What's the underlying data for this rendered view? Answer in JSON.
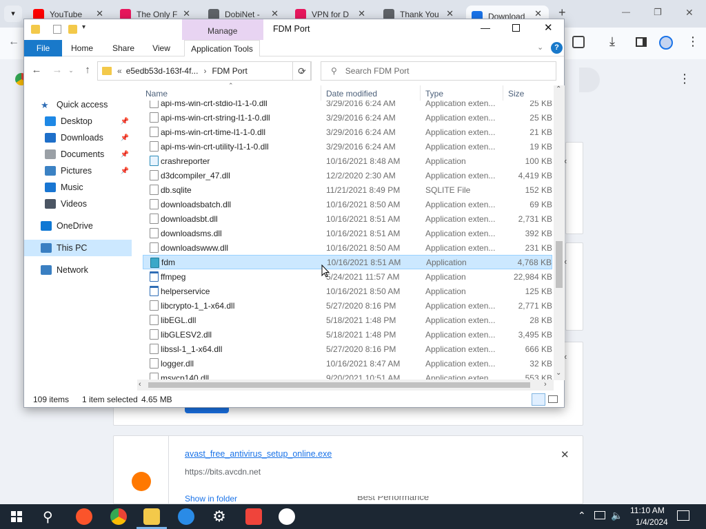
{
  "browser": {
    "tabs": [
      {
        "title": "YouTube",
        "icon": "youtube-icon",
        "color": "#ff0000"
      },
      {
        "title": "The Only F",
        "icon": "android-icon",
        "color": "#e8175d"
      },
      {
        "title": "DobiNet -",
        "icon": "globe-icon",
        "color": "#5f6368"
      },
      {
        "title": "VPN for D",
        "icon": "android-icon",
        "color": "#e8175d"
      },
      {
        "title": "Thank You",
        "icon": "globe-icon",
        "color": "#5f6368"
      },
      {
        "title": "Download",
        "icon": "download-icon",
        "color": "#1a73e8"
      }
    ],
    "new_tab": "+",
    "window_controls": {
      "minimize": "—",
      "maximize": "❐",
      "close": "✕"
    }
  },
  "downloads_page": {
    "item_filename": "avast_free_antivirus_setup_online.exe",
    "item_url": "https://bits.avcdn.net",
    "show_in_folder": "Show in folder",
    "bg_hint": "Best Performance"
  },
  "explorer": {
    "title": "FDM Port",
    "manage_label": "Manage",
    "ribbon_tabs": [
      "File",
      "Home",
      "Share",
      "View",
      "Application Tools"
    ],
    "address": {
      "part1": "e5edb53d-163f-4f...",
      "sep": "›",
      "part2": "FDM Port"
    },
    "search_placeholder": "Search FDM Port",
    "columns": {
      "name": "Name",
      "date": "Date modified",
      "type": "Type",
      "size": "Size"
    },
    "nav": [
      {
        "label": "Quick access",
        "icon": "star-icon",
        "color": "#2f6db5",
        "indent": 0,
        "pinned": false
      },
      {
        "label": "Desktop",
        "icon": "desktop-icon",
        "color": "#1e88e5",
        "indent": 1,
        "pinned": true
      },
      {
        "label": "Downloads",
        "icon": "downloads-icon",
        "color": "#1e6fc9",
        "indent": 1,
        "pinned": true
      },
      {
        "label": "Documents",
        "icon": "documents-icon",
        "color": "#9aa0a6",
        "indent": 1,
        "pinned": true
      },
      {
        "label": "Pictures",
        "icon": "pictures-icon",
        "color": "#3b82c4",
        "indent": 1,
        "pinned": true
      },
      {
        "label": "Music",
        "icon": "music-icon",
        "color": "#1976d2",
        "indent": 1,
        "pinned": false
      },
      {
        "label": "Videos",
        "icon": "videos-icon",
        "color": "#4b5563",
        "indent": 1,
        "pinned": false
      },
      {
        "label": "OneDrive",
        "icon": "onedrive-icon",
        "color": "#0f78d4",
        "indent": 0,
        "pinned": false
      },
      {
        "label": "This PC",
        "icon": "computer-icon",
        "color": "#3a7fc2",
        "indent": 0,
        "pinned": false
      },
      {
        "label": "Network",
        "icon": "network-icon",
        "color": "#3a7fc2",
        "indent": 0,
        "pinned": false
      }
    ],
    "files": [
      {
        "name": "api-ms-win-crt-stdio-l1-1-0.dll",
        "date": "3/29/2016 6:24 AM",
        "type": "Application exten...",
        "size": "25 KB",
        "kind": "dll"
      },
      {
        "name": "api-ms-win-crt-string-l1-1-0.dll",
        "date": "3/29/2016 6:24 AM",
        "type": "Application exten...",
        "size": "25 KB",
        "kind": "dll"
      },
      {
        "name": "api-ms-win-crt-time-l1-1-0.dll",
        "date": "3/29/2016 6:24 AM",
        "type": "Application exten...",
        "size": "21 KB",
        "kind": "dll"
      },
      {
        "name": "api-ms-win-crt-utility-l1-1-0.dll",
        "date": "3/29/2016 6:24 AM",
        "type": "Application exten...",
        "size": "19 KB",
        "kind": "dll"
      },
      {
        "name": "crashreporter",
        "date": "10/16/2021 8:48 AM",
        "type": "Application",
        "size": "100 KB",
        "kind": "crash"
      },
      {
        "name": "d3dcompiler_47.dll",
        "date": "12/2/2020 2:30 AM",
        "type": "Application exten...",
        "size": "4,419 KB",
        "kind": "dll"
      },
      {
        "name": "db.sqlite",
        "date": "11/21/2021 8:49 PM",
        "type": "SQLITE File",
        "size": "152 KB",
        "kind": "file"
      },
      {
        "name": "downloadsbatch.dll",
        "date": "10/16/2021 8:50 AM",
        "type": "Application exten...",
        "size": "69 KB",
        "kind": "dll"
      },
      {
        "name": "downloadsbt.dll",
        "date": "10/16/2021 8:51 AM",
        "type": "Application exten...",
        "size": "2,731 KB",
        "kind": "dll"
      },
      {
        "name": "downloadsms.dll",
        "date": "10/16/2021 8:51 AM",
        "type": "Application exten...",
        "size": "392 KB",
        "kind": "dll"
      },
      {
        "name": "downloadswww.dll",
        "date": "10/16/2021 8:50 AM",
        "type": "Application exten...",
        "size": "231 KB",
        "kind": "dll"
      },
      {
        "name": "fdm",
        "date": "10/16/2021 8:51 AM",
        "type": "Application",
        "size": "4,768 KB",
        "kind": "fdm",
        "selected": true
      },
      {
        "name": "ffmpeg",
        "date": "5/24/2021 11:57 AM",
        "type": "Application",
        "size": "22,984 KB",
        "kind": "app"
      },
      {
        "name": "helperservice",
        "date": "10/16/2021 8:50 AM",
        "type": "Application",
        "size": "125 KB",
        "kind": "app"
      },
      {
        "name": "libcrypto-1_1-x64.dll",
        "date": "5/27/2020 8:16 PM",
        "type": "Application exten...",
        "size": "2,771 KB",
        "kind": "dll"
      },
      {
        "name": "libEGL.dll",
        "date": "5/18/2021 1:48 PM",
        "type": "Application exten...",
        "size": "28 KB",
        "kind": "dll"
      },
      {
        "name": "libGLESV2.dll",
        "date": "5/18/2021 1:48 PM",
        "type": "Application exten...",
        "size": "3,495 KB",
        "kind": "dll"
      },
      {
        "name": "libssl-1_1-x64.dll",
        "date": "5/27/2020 8:16 PM",
        "type": "Application exten...",
        "size": "666 KB",
        "kind": "dll"
      },
      {
        "name": "logger.dll",
        "date": "10/16/2021 8:47 AM",
        "type": "Application exten...",
        "size": "32 KB",
        "kind": "dll"
      },
      {
        "name": "msvcp140.dll",
        "date": "9/20/2021 10:51 AM",
        "type": "Application exten...",
        "size": "553 KB",
        "kind": "dll"
      }
    ],
    "status": {
      "count": "109 items",
      "selected": "1 item selected",
      "size": "4.65 MB"
    }
  },
  "taskbar": {
    "time": "11:10 AM",
    "date": "1/4/2024"
  }
}
